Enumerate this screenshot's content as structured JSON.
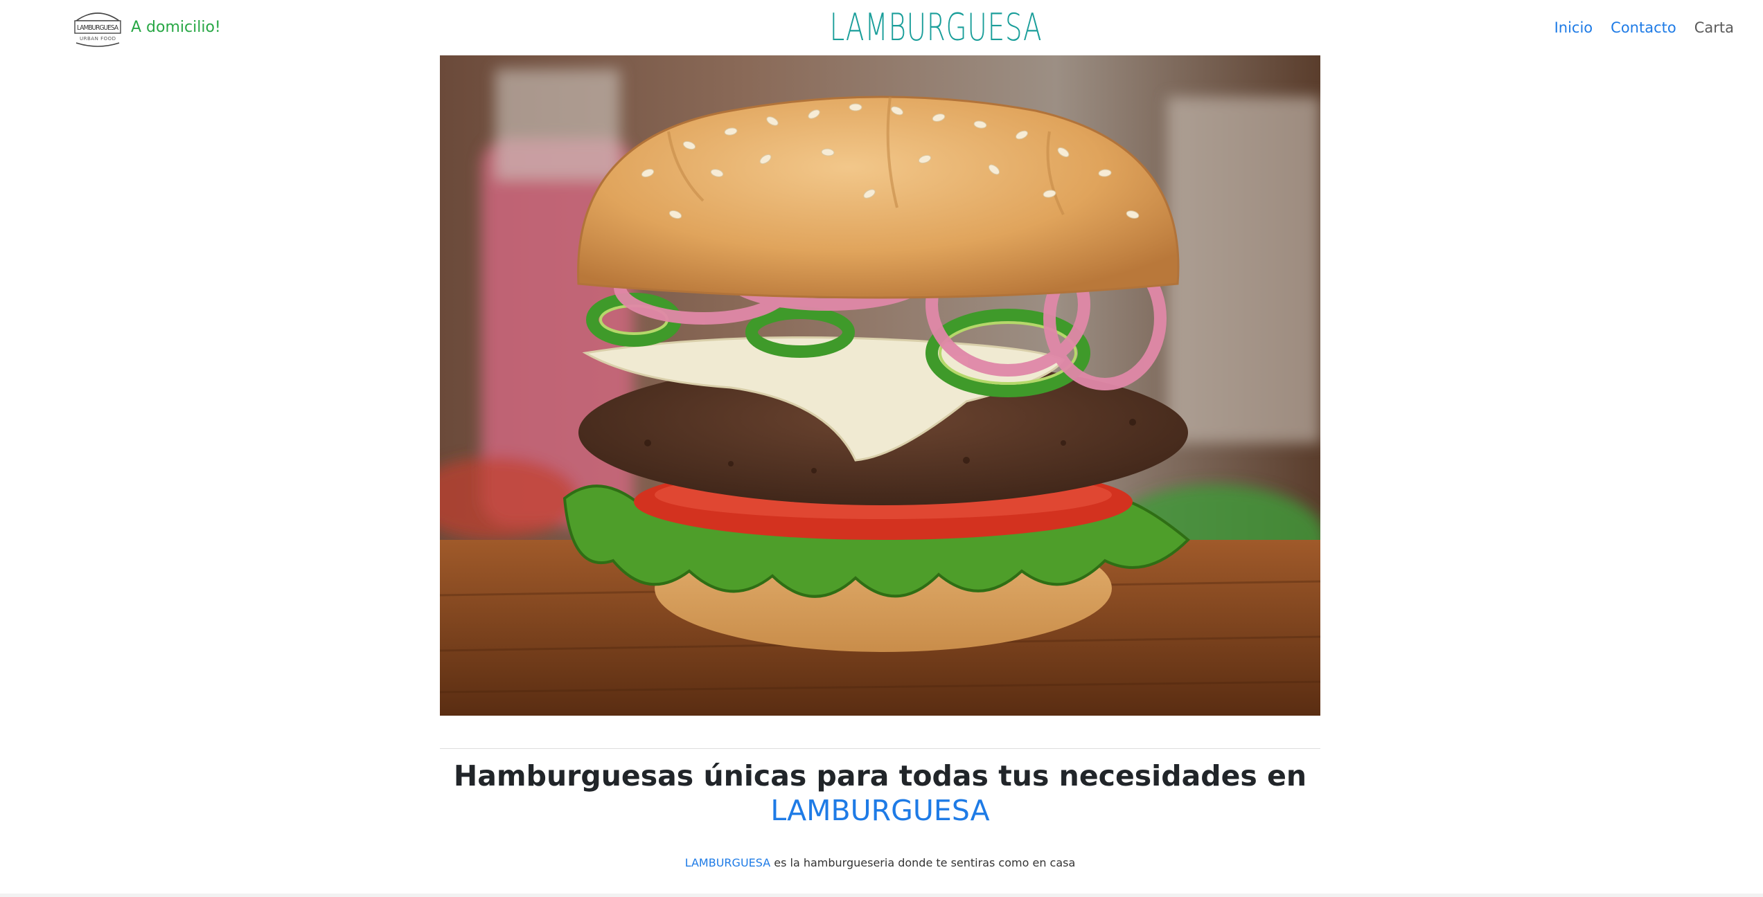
{
  "navbar": {
    "logo": {
      "icon": "burger-logo-icon",
      "title": "LAMBURGUESA",
      "subtitle": "URBAN FOOD"
    },
    "delivery_text": "A domicilio!",
    "site_title": "LAMBURGUESA",
    "links": [
      {
        "label": "Inicio"
      },
      {
        "label": "Contacto"
      },
      {
        "label": "Carta"
      }
    ]
  },
  "hero": {
    "image": "burger-photo"
  },
  "main": {
    "headline": "Hamburguesas únicas para todas tus necesidades en",
    "headline_brand": "LAMBURGUESA",
    "tagline_brand": "LAMBURGUESA",
    "tagline_text": " es la hamburgueseria donde te sentiras como en casa"
  },
  "colors": {
    "accent_blue": "#1e7be6",
    "title_teal": "#1a9e9a",
    "delivery_green": "#28a745"
  }
}
